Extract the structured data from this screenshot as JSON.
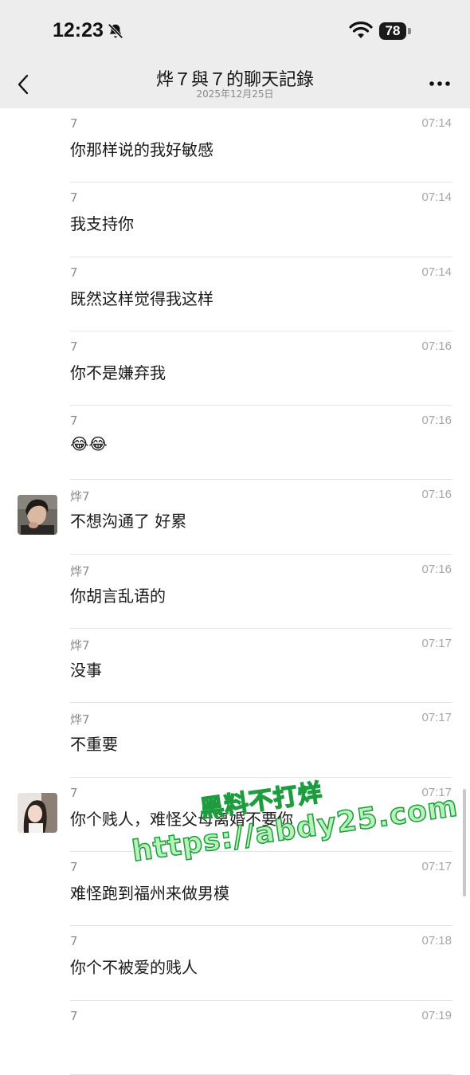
{
  "status": {
    "time": "12:23",
    "battery": "78"
  },
  "header": {
    "title": "烨７與７的聊天記錄",
    "subtitle": "2025年12月25日"
  },
  "messages": [
    {
      "sender": "7",
      "time": "07:14",
      "text": "你那样说的我好敏感",
      "avatar": null
    },
    {
      "sender": "7",
      "time": "07:14",
      "text": "我支持你",
      "avatar": null
    },
    {
      "sender": "7",
      "time": "07:14",
      "text": "既然这样觉得我这样",
      "avatar": null
    },
    {
      "sender": "7",
      "time": "07:16",
      "text": "你不是嫌弃我",
      "avatar": null
    },
    {
      "sender": "7",
      "time": "07:16",
      "text": "😂😂",
      "avatar": null
    },
    {
      "sender": "烨7",
      "time": "07:16",
      "text": "不想沟通了 好累",
      "avatar": "dark"
    },
    {
      "sender": "烨7",
      "time": "07:16",
      "text": "你胡言乱语的",
      "avatar": null
    },
    {
      "sender": "烨7",
      "time": "07:17",
      "text": "没事",
      "avatar": null
    },
    {
      "sender": "烨7",
      "time": "07:17",
      "text": "不重要",
      "avatar": null
    },
    {
      "sender": "7",
      "time": "07:17",
      "text": "你个贱人，难怪父母离婚不要你",
      "avatar": "light"
    },
    {
      "sender": "7",
      "time": "07:17",
      "text": "难怪跑到福州来做男模",
      "avatar": null
    },
    {
      "sender": "7",
      "time": "07:18",
      "text": "你个不被爱的贱人",
      "avatar": null
    },
    {
      "sender": "7",
      "time": "07:19",
      "text": "",
      "avatar": null
    }
  ],
  "watermark": {
    "line1": "黑料不打烊",
    "line2": "https://abdy25.com"
  },
  "colors": {
    "header_bg": "#ededed",
    "watermark_fill": "#b7f2b8",
    "watermark_stroke": "#1f9c3f"
  }
}
